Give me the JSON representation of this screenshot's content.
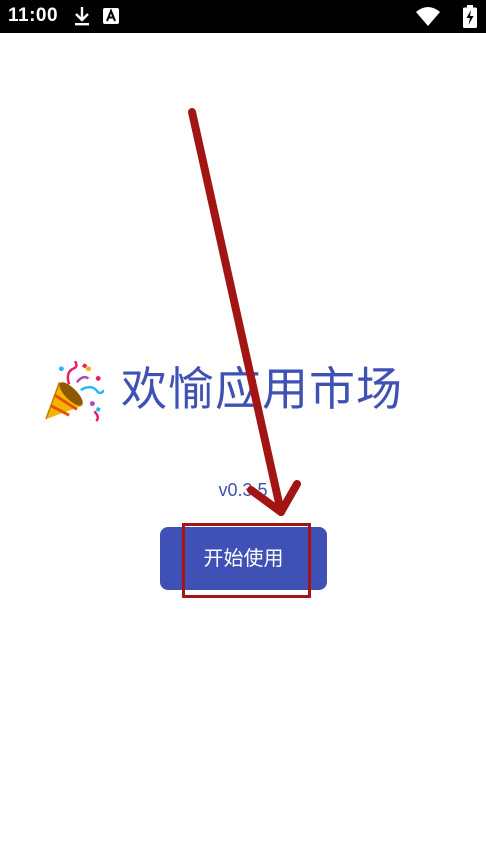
{
  "status_bar": {
    "time": "11:00",
    "icons": [
      "download-icon",
      "a-notification-icon",
      "wifi-icon",
      "battery-charging-icon"
    ]
  },
  "main": {
    "title": "欢愉应用市场",
    "title_icon": "party-popper-icon",
    "version": "v0.3.5",
    "start_button_label": "开始使用"
  },
  "colors": {
    "accent": "#3f51b5",
    "annotation": "#a31515",
    "status_bar_bg": "#000000",
    "background": "#ffffff"
  }
}
